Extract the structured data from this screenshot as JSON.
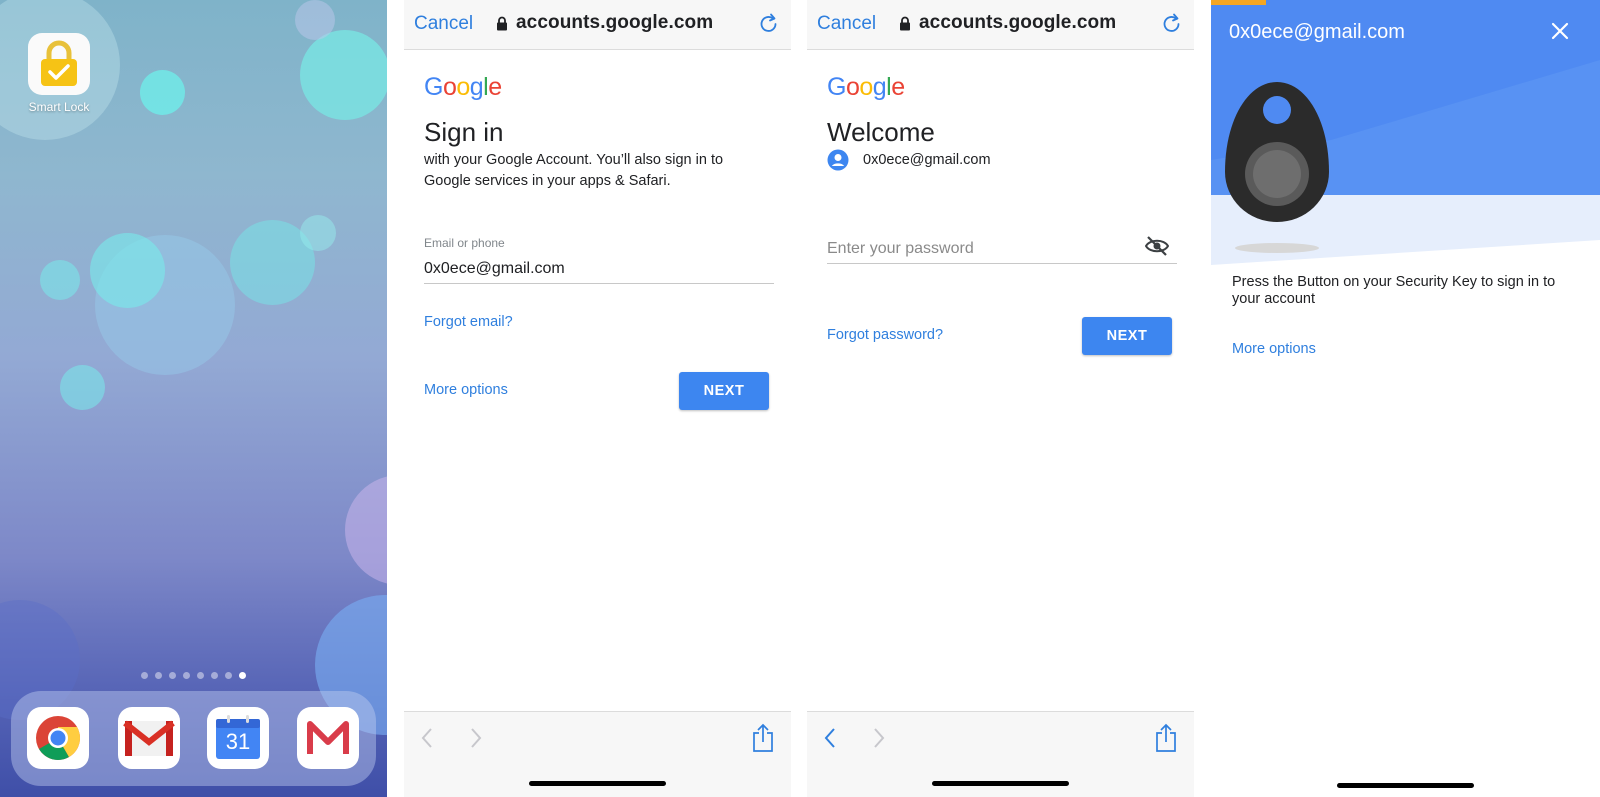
{
  "home": {
    "smart_lock_label": "Smart Lock",
    "page_dot_count": 8,
    "active_page_index": 7,
    "dock_apps": [
      "chrome-icon",
      "gmail-icon",
      "calendar-icon",
      "gmail-m-icon"
    ],
    "calendar_day": "31"
  },
  "browser": {
    "cancel_label": "Cancel",
    "url": "accounts.google.com"
  },
  "logo_letters": [
    "G",
    "o",
    "o",
    "g",
    "l",
    "e"
  ],
  "logo_colors": [
    "#4285F4",
    "#EA4335",
    "#FBBC05",
    "#4285F4",
    "#34A853",
    "#EA4335"
  ],
  "signin": {
    "title": "Sign in",
    "subtitle": "with your Google Account. You’ll also sign in to Google services in your apps & Safari.",
    "email_label": "Email or phone",
    "email_value": "0x0ece@gmail.com",
    "forgot_email": "Forgot email?",
    "more_options": "More options",
    "next": "NEXT"
  },
  "welcome": {
    "title": "Welcome",
    "account_email": "0x0ece@gmail.com",
    "password_placeholder": "Enter your password",
    "forgot_password": "Forgot password?",
    "next": "NEXT"
  },
  "security_key": {
    "email": "0x0ece@gmail.com",
    "instruction": "Press the Button on your Security Key to sign in to your account",
    "more_options": "More options"
  },
  "colors": {
    "link_blue": "#2f7fde",
    "button_blue": "#3d86f0",
    "header_blue": "#4f8af2",
    "progress_orange": "#f5a623"
  }
}
